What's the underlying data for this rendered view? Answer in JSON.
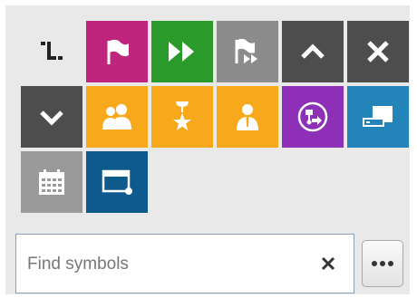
{
  "symbols": [
    {
      "icon": "step-number-icon",
      "color": "#e9e9e9"
    },
    {
      "icon": "flag-icon",
      "color": "#c0257e"
    },
    {
      "icon": "fast-forward-icon",
      "color": "#2a9a2a"
    },
    {
      "icon": "flag-forward-icon",
      "color": "#8c8c8c"
    },
    {
      "icon": "chevron-up-icon",
      "color": "#4d4d4d"
    },
    {
      "icon": "close-icon",
      "color": "#4d4d4d"
    },
    {
      "icon": "chevron-down-icon",
      "color": "#4d4d4d"
    },
    {
      "icon": "group-icon",
      "color": "#f7a81b"
    },
    {
      "icon": "trophy-star-icon",
      "color": "#f7a81b"
    },
    {
      "icon": "person-icon",
      "color": "#f7a81b"
    },
    {
      "icon": "workflow-icon",
      "color": "#8e2fb8"
    },
    {
      "icon": "device-tag-icon",
      "color": "#2284b8"
    },
    {
      "icon": "calendar-icon",
      "color": "#9a9a9a"
    },
    {
      "icon": "window-icon",
      "color": "#0f5a8c"
    }
  ],
  "search": {
    "placeholder": "Find symbols",
    "clear_icon": "close-icon"
  },
  "more_button": {
    "icon": "ellipsis-icon"
  }
}
